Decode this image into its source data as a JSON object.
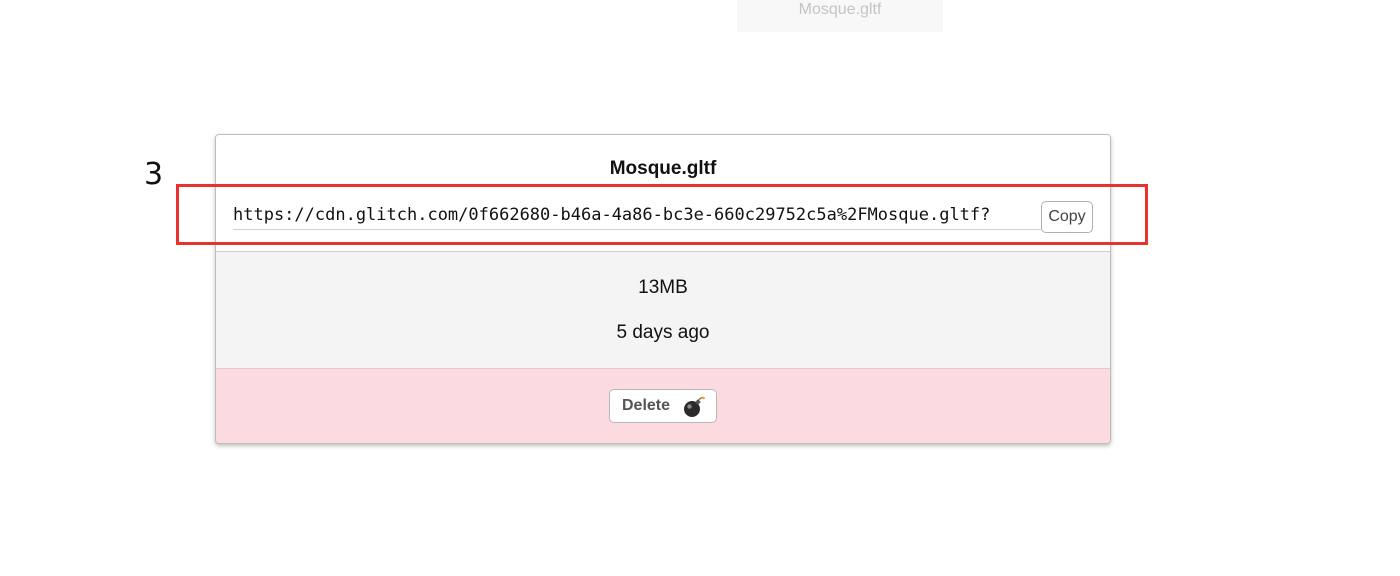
{
  "background_tile": {
    "label": "Mosque.gltf"
  },
  "annotation": {
    "step_number": "3",
    "highlight_color": "#e8322d"
  },
  "asset_popover": {
    "title": "Mosque.gltf",
    "url_value": "https://cdn.glitch.com/0f662680-b46a-4a86-bc3e-660c29752c5a%2FMosque.gltf?",
    "copy_label": "Copy",
    "size": "13MB",
    "uploaded": "5 days ago",
    "delete_label": "Delete",
    "delete_icon": "bomb-icon",
    "danger_background": "#fbdbdf"
  }
}
